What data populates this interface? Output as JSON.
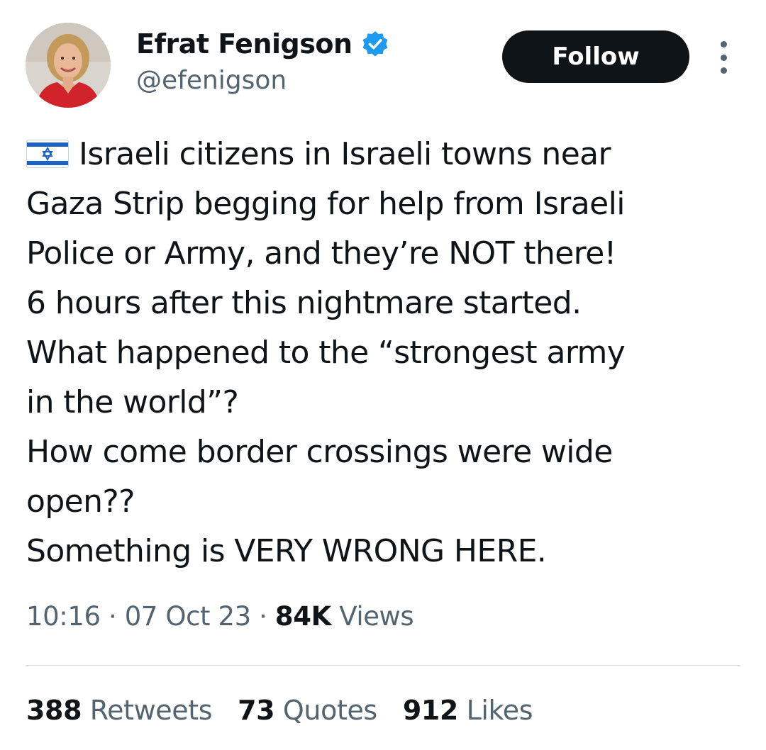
{
  "author": {
    "display_name": "Efrat Fenigson",
    "handle": "@efenigson",
    "verified": true,
    "avatar_icon": "profile-photo"
  },
  "actions": {
    "follow_label": "Follow",
    "more_icon": "more-dots-icon"
  },
  "tweet": {
    "flag_icon": "israel-flag-icon",
    "lines": [
      "Israeli citizens in Israeli towns near",
      "Gaza Strip begging for help from Israeli",
      "Police or Army, and they’re NOT there!",
      "6 hours after this nightmare started.",
      "What happened to the “strongest army",
      "in the world”?",
      "How come border crossings were wide",
      "open??",
      "Something is VERY WRONG HERE."
    ]
  },
  "meta": {
    "time": "10:16",
    "separator": " · ",
    "date": "07 Oct 23",
    "views_count": "84K",
    "views_label": " Views"
  },
  "stats": {
    "retweets_count": "388",
    "retweets_label": " Retweets",
    "quotes_count": "73",
    "quotes_label": " Quotes",
    "likes_count": "912",
    "likes_label": " Likes"
  },
  "colors": {
    "text_primary": "#0f1419",
    "text_secondary": "#536471",
    "verified_blue": "#1d9bf0",
    "follow_bg": "#0f1419",
    "divider": "#cfd9de"
  }
}
